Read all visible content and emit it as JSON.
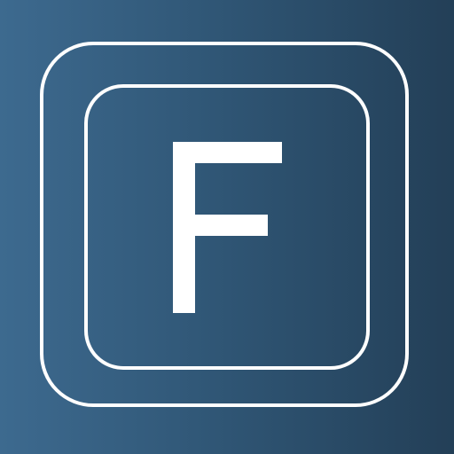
{
  "icon": {
    "letter": "F",
    "colors": {
      "background_left": "#3d6a8f",
      "background_right": "#233f57",
      "foreground": "#ffffff"
    }
  }
}
